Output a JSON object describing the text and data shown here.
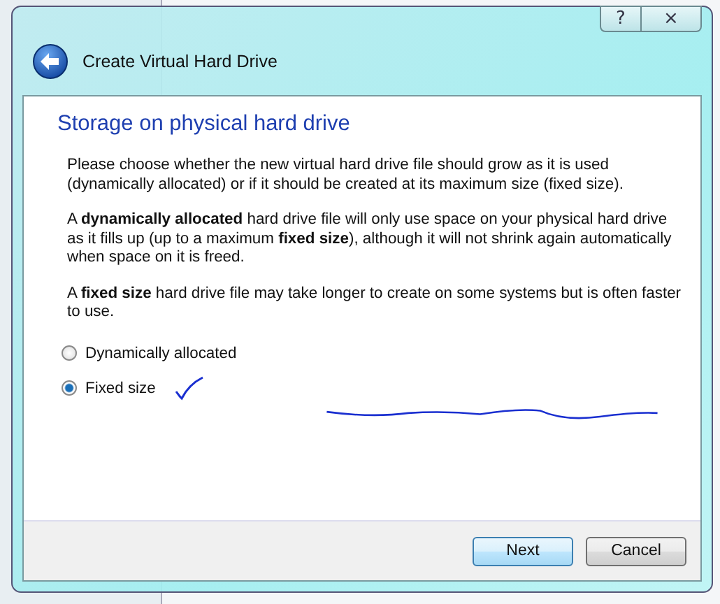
{
  "window": {
    "title": "Create Virtual Hard Drive",
    "help_button": "?",
    "close_button": "×"
  },
  "page": {
    "heading": "Storage on physical hard drive",
    "paragraphs": [
      "Please choose whether the new virtual hard drive file should grow as it is used (dynamically allocated) or if it should be created at its maximum size (fixed size).",
      "A **dynamically allocated** hard drive file will only use space on your physical hard drive as it fills up (up to a maximum **fixed size**), although it will not shrink again automatically when space on it is freed.",
      "A **fixed size** hard drive file may take longer to create on some systems but is often faster to use."
    ],
    "options": [
      {
        "label": "Dynamically allocated",
        "selected": false
      },
      {
        "label": "Fixed size",
        "selected": true
      }
    ]
  },
  "buttons": [
    {
      "label": "Next",
      "default": true
    },
    {
      "label": "Cancel",
      "default": false
    }
  ]
}
